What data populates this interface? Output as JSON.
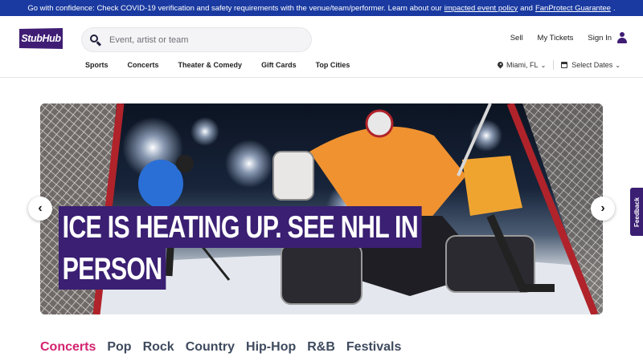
{
  "banner": {
    "text": "Go with confidence: Check COVID-19 verification and safety requirements with the venue/team/performer. Learn about our",
    "link1": "impacted event policy",
    "and": "and",
    "link2": "FanProtect Guarantee",
    "end": "."
  },
  "header": {
    "logo": "StubHub",
    "search_placeholder": "Event, artist or team",
    "links": {
      "sell": "Sell",
      "my_tickets": "My Tickets",
      "sign_in": "Sign In"
    },
    "categories": [
      "Sports",
      "Concerts",
      "Theater & Comedy",
      "Gift Cards",
      "Top Cities"
    ],
    "location": "Miami, FL",
    "dates": "Select Dates"
  },
  "hero": {
    "line1": "ICE IS HEATING UP. SEE NHL IN",
    "line2": "PERSON"
  },
  "feedback": "Feedback",
  "tabs": [
    "Concerts",
    "Pop",
    "Rock",
    "Country",
    "Hip-Hop",
    "R&B",
    "Festivals"
  ],
  "colors": {
    "brand": "#3f1d74",
    "banner": "#1a3aa1",
    "tab_active": "#d2246f"
  }
}
